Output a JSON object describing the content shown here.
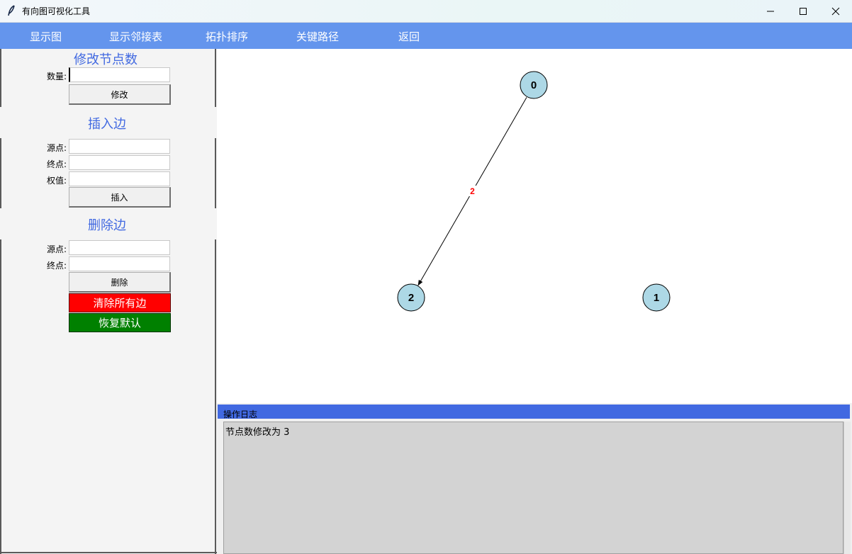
{
  "window": {
    "title": "有向图可视化工具",
    "icons": {
      "app": "feather-icon",
      "minimize": "minimize-icon",
      "maximize": "maximize-icon",
      "close": "close-icon"
    }
  },
  "menu": {
    "items": [
      "显示图",
      "显示邻接表",
      "拓扑排序",
      "关键路径",
      "返回"
    ]
  },
  "panel": {
    "modify_nodes": {
      "title": "修改节点数",
      "count_label": "数量:",
      "count_value": "",
      "button": "修改"
    },
    "insert_edge": {
      "title": "插入边",
      "source_label": "源点:",
      "target_label": "终点:",
      "weight_label": "权值:",
      "button": "插入"
    },
    "delete_edge": {
      "title": "删除边",
      "source_label": "源点:",
      "target_label": "终点:",
      "button": "删除"
    },
    "clear_button": "清除所有边",
    "reset_button": "恢复默认"
  },
  "graph": {
    "nodes": [
      {
        "id": "0",
        "label": "0"
      },
      {
        "id": "1",
        "label": "1"
      },
      {
        "id": "2",
        "label": "2"
      }
    ],
    "edges": [
      {
        "from": "0",
        "to": "2",
        "weight": "2"
      }
    ],
    "colors": {
      "node_fill": "#add8e6",
      "edge": "#000000",
      "weight": "#ff0000"
    }
  },
  "log": {
    "title": "操作日志",
    "lines": [
      "节点数修改为 3"
    ]
  },
  "colors": {
    "menu_bar": "#6495ed",
    "section_title": "#4169e1",
    "log_header": "#4169e1",
    "clear_button": "#ff0000",
    "reset_button": "#008000"
  }
}
